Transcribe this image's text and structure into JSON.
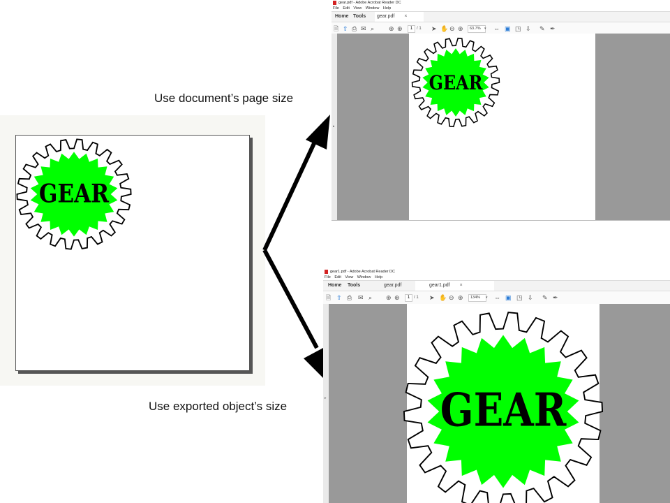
{
  "captions": {
    "top": "Use document’s page size",
    "bottom": "Use exported object’s size"
  },
  "gear": {
    "label": "GEAR",
    "fill_color": "#00ff00",
    "outline_color": "#000000"
  },
  "windows": {
    "top": {
      "title": "gear.pdf - Adobe Acrobat Reader DC",
      "menu": [
        "File",
        "Edit",
        "View",
        "Window",
        "Help"
      ],
      "tabs": {
        "home": "Home",
        "tools": "Tools",
        "file1": "gear.pdf"
      },
      "tab_close": "×",
      "page_current": "1",
      "page_total": "/ 1",
      "zoom": "63.7%",
      "zoom_arrow": "▾"
    },
    "bottom": {
      "title": "gear1.pdf - Adobe Acrobat Reader DC",
      "menu": [
        "File",
        "Edit",
        "View",
        "Window",
        "Help"
      ],
      "tabs": {
        "home": "Home",
        "tools": "Tools",
        "file1": "gear.pdf",
        "file2": "gear1.pdf"
      },
      "tab_close": "×",
      "page_current": "1",
      "page_total": "/ 1",
      "zoom": "134%",
      "zoom_arrow": "▾"
    }
  },
  "icons": {
    "side_arrow": "▸",
    "toolbar": [
      "save-icon",
      "upload-icon",
      "print-icon",
      "email-icon",
      "search-icon",
      "page-up-icon",
      "page-down-icon",
      "select-arrow-icon",
      "hand-icon",
      "zoom-out-icon",
      "zoom-in-icon",
      "fit-width-icon",
      "page-view-icon",
      "fullscreen-icon",
      "scroll-mode-icon",
      "comment-icon",
      "sign-icon"
    ]
  }
}
